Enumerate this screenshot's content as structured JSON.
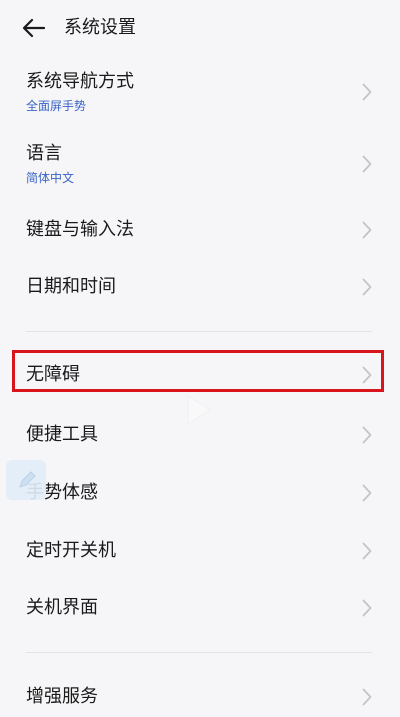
{
  "header": {
    "back_icon": "arrow-left-icon",
    "title": "系统设置"
  },
  "items": [
    {
      "title": "系统导航方式",
      "subtitle": "全面屏手势"
    },
    {
      "title": "语言",
      "subtitle": "简体中文"
    },
    {
      "title": "键盘与输入法"
    },
    {
      "title": "日期和时间"
    },
    {
      "title": "无障碍"
    },
    {
      "title": "便捷工具"
    },
    {
      "title": "手势体感"
    },
    {
      "title": "定时开关机"
    },
    {
      "title": "关机界面"
    },
    {
      "title": "增强服务"
    }
  ],
  "icons": {
    "chevron": "chevron-right-icon",
    "floating_button": "edit-icon",
    "overlay": "play-icon"
  },
  "colors": {
    "background": "#f6f6f8",
    "subtitle": "#3a63c7",
    "highlight": "#d8141c",
    "chevron": "#c4c4c8",
    "divider": "#e3e3e6"
  }
}
